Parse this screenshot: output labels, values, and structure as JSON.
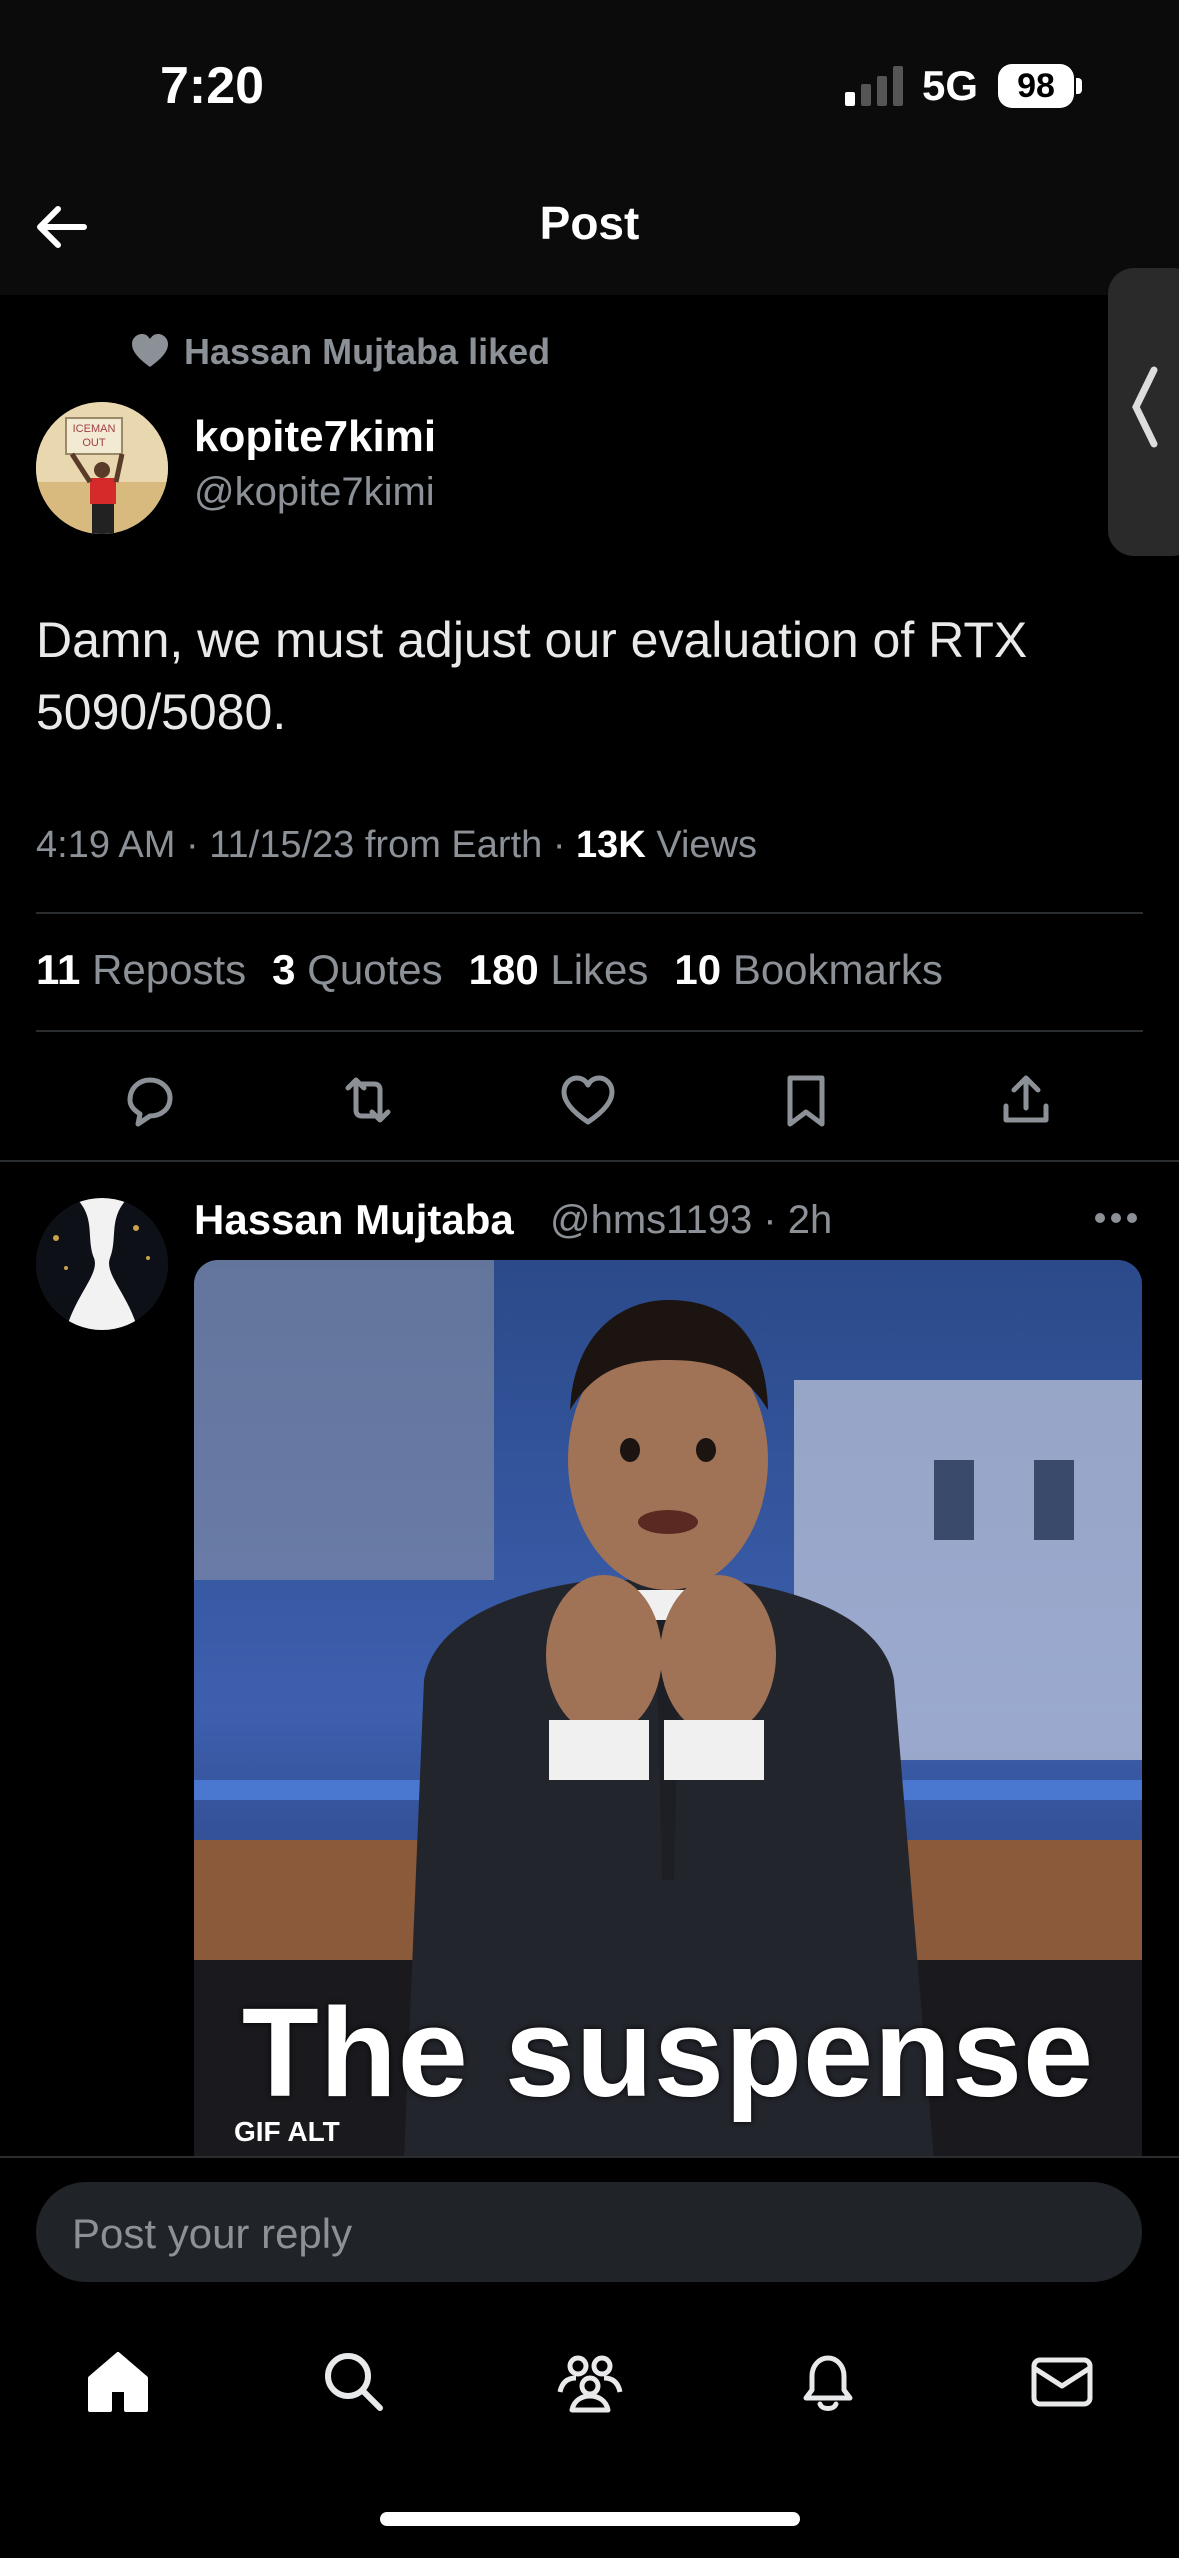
{
  "status_bar": {
    "time": "7:20",
    "network": "5G",
    "battery": "98"
  },
  "header": {
    "title": "Post"
  },
  "social_context": {
    "text": "Hassan Mujtaba liked"
  },
  "author": {
    "name": "kopite7kimi",
    "handle": "@kopite7kimi",
    "avatar_sign_text": "ICEMAN OUT"
  },
  "tweet": {
    "text": "Damn, we must adjust our evaluation of RTX\n5090/5080.",
    "time": "4:19 AM",
    "date": "11/15/23",
    "source": "from Earth",
    "views_count": "13K",
    "views_label": "Views"
  },
  "stats": [
    {
      "count": "11",
      "label": "Reposts"
    },
    {
      "count": "3",
      "label": "Quotes"
    },
    {
      "count": "180",
      "label": "Likes"
    },
    {
      "count": "10",
      "label": "Bookmarks"
    }
  ],
  "actions": [
    "reply-icon",
    "repost-icon",
    "like-icon",
    "bookmark-icon",
    "share-icon"
  ],
  "reply": {
    "name": "Hassan Mujtaba",
    "handle": "@hms1193 · 2h",
    "media_caption": "The suspense",
    "media_badge": "GIF   ALT"
  },
  "composer": {
    "placeholder": "Post your reply"
  },
  "bottom_nav": [
    "home-icon",
    "search-icon",
    "communities-icon",
    "notifications-icon",
    "messages-icon"
  ]
}
